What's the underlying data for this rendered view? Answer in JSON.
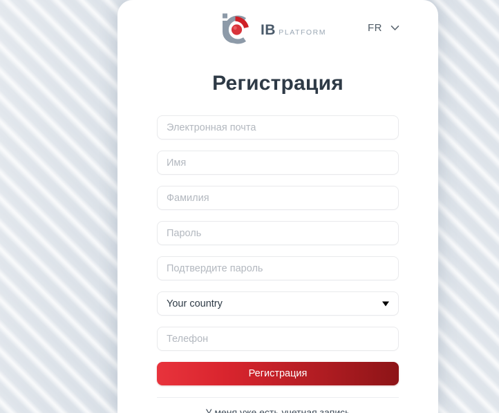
{
  "brand": {
    "logo_icon": "ib-platform-logo-icon",
    "title": "IB",
    "subtitle": "PLATFORM",
    "accent_color": "#d9252e",
    "mark_gray": "#8d9aa8"
  },
  "header": {
    "language": {
      "code": "FR",
      "chevron_icon": "chevron-down-icon"
    }
  },
  "main": {
    "title": "Регистрация"
  },
  "form": {
    "fields": [
      {
        "name": "email",
        "placeholder": "Электронная почта",
        "value": "",
        "type": "text"
      },
      {
        "name": "first-name",
        "placeholder": "Имя",
        "value": "",
        "type": "text"
      },
      {
        "name": "last-name",
        "placeholder": "Фамилия",
        "value": "",
        "type": "text"
      },
      {
        "name": "password",
        "placeholder": "Пароль",
        "value": "",
        "type": "password"
      },
      {
        "name": "confirm-password",
        "placeholder": "Подтвердите пароль",
        "value": "",
        "type": "password"
      },
      {
        "name": "phone",
        "placeholder": "Телефон",
        "value": "",
        "type": "text"
      }
    ],
    "country": {
      "selected": "Your country",
      "arrow_icon": "triangle-down-icon"
    },
    "submit_label": "Регистрация",
    "login_link": "У меня уже есть учетная запись"
  }
}
